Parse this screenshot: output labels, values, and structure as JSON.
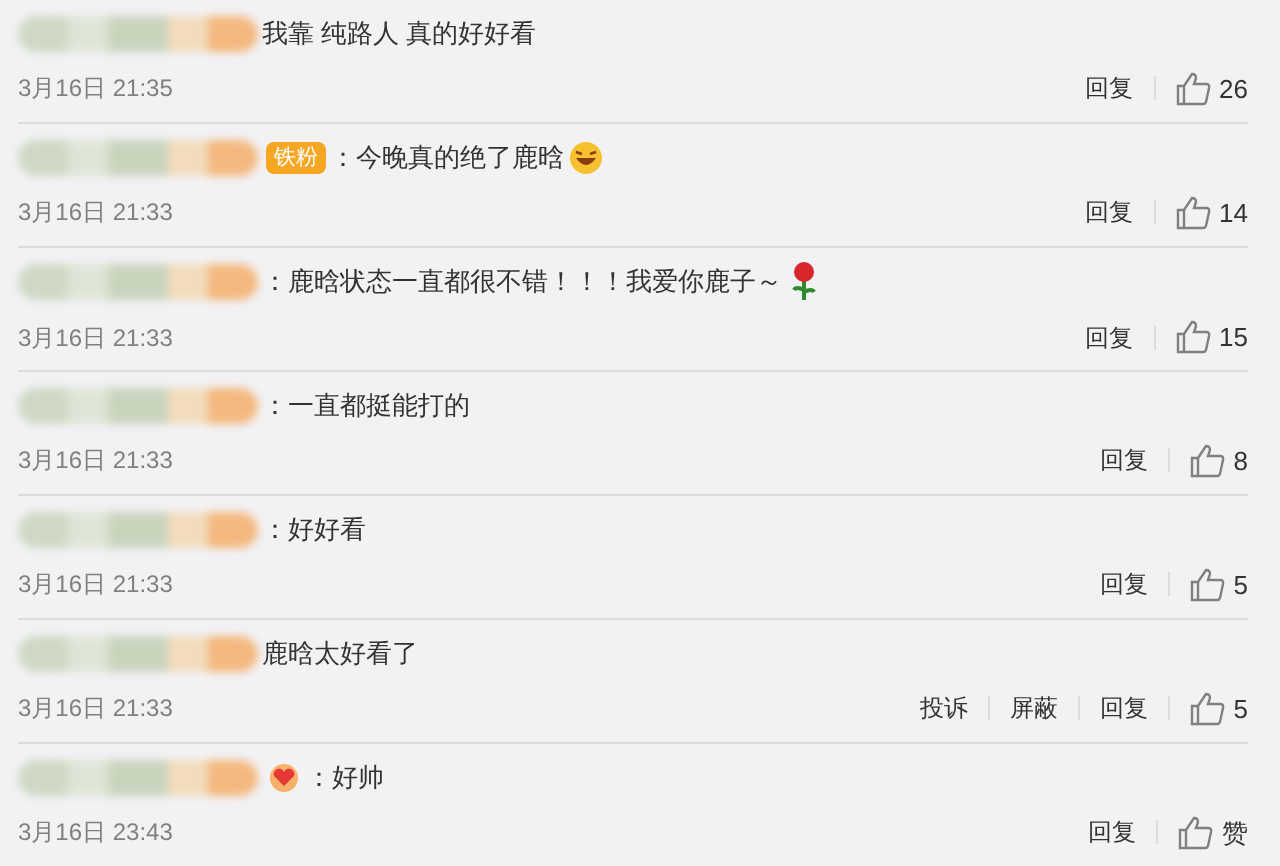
{
  "comments": [
    {
      "text": "我靠 纯路人 真的好好看",
      "time": "3月16日 21:35",
      "actions": [
        "回复"
      ],
      "likes": "26"
    },
    {
      "badge_label": "铁粉",
      "text": "：今晚真的绝了鹿晗",
      "kind": "smile",
      "time": "3月16日 21:33",
      "actions": [
        "回复"
      ],
      "likes": "14"
    },
    {
      "text": "：鹿晗状态一直都很不错！！！我爱你鹿子～",
      "kind": "rose",
      "time": "3月16日 21:33",
      "actions": [
        "回复"
      ],
      "likes": "15"
    },
    {
      "text": "：一直都挺能打的",
      "time": "3月16日 21:33",
      "actions": [
        "回复"
      ],
      "likes": "8"
    },
    {
      "text": "：好好看",
      "time": "3月16日 21:33",
      "actions": [
        "回复"
      ],
      "likes": "5"
    },
    {
      "text": "鹿晗太好看了",
      "time": "3月16日 21:33",
      "actions": [
        "投诉",
        "屏蔽",
        "回复"
      ],
      "likes": "5"
    },
    {
      "text": "：好帅",
      "kind": "heart",
      "time": "3月16日 23:43",
      "actions": [
        "回复"
      ],
      "likes": "赞"
    }
  ]
}
